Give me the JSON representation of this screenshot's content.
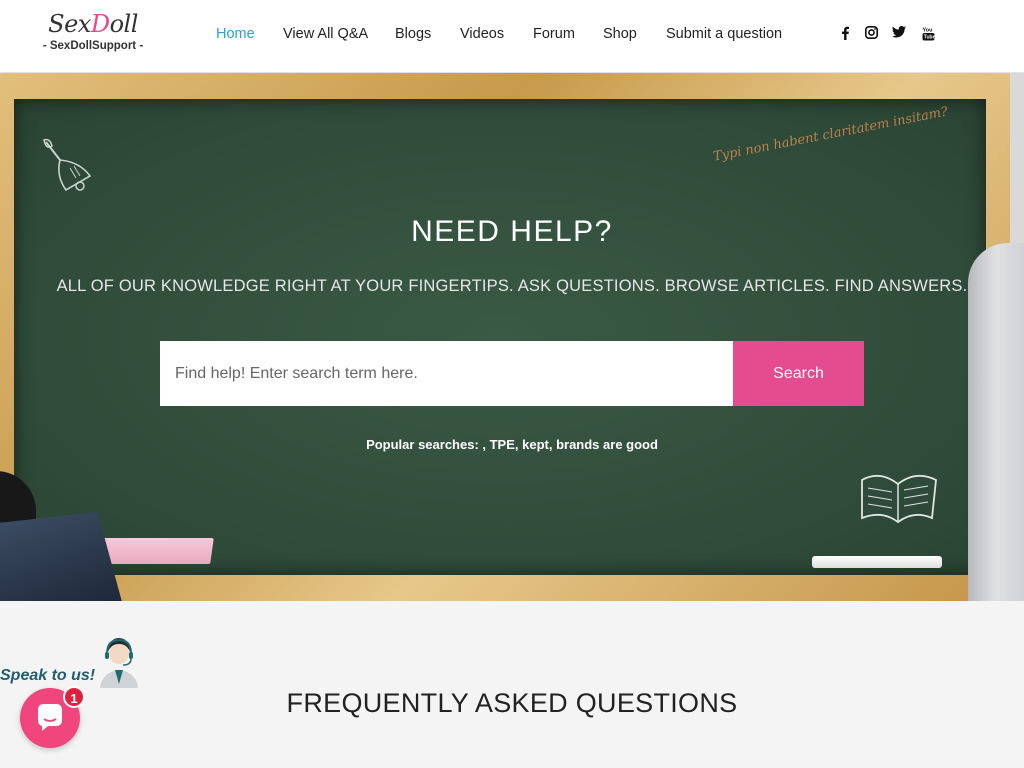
{
  "header": {
    "logo": {
      "main_prefix": "Sex",
      "main_accent": "D",
      "main_suffix": "oll",
      "sub": "- SexDollSupport -"
    },
    "nav": [
      {
        "label": "Home",
        "active": true
      },
      {
        "label": "View All Q&A"
      },
      {
        "label": "Blogs"
      },
      {
        "label": "Videos"
      },
      {
        "label": "Forum"
      },
      {
        "label": "Shop"
      },
      {
        "label": "Submit a question"
      }
    ],
    "social": [
      {
        "icon": "facebook-icon",
        "glyph": "f"
      },
      {
        "icon": "instagram-icon",
        "glyph": "◙"
      },
      {
        "icon": "twitter-icon",
        "glyph": "🐦"
      },
      {
        "icon": "youtube-icon",
        "glyph": "▶"
      }
    ]
  },
  "hero": {
    "chalk_note": "Typi non habent claritatem insitam?",
    "title": "NEED HELP?",
    "subtitle": "ALL OF OUR KNOWLEDGE RIGHT AT YOUR FINGERTIPS. ASK QUESTIONS. BROWSE ARTICLES. FIND ANSWERS.",
    "search": {
      "placeholder": "Find help! Enter search term here.",
      "value": "",
      "button_label": "Search"
    },
    "popular_searches": "Popular searches: , TPE, kept, brands are good"
  },
  "faq": {
    "title": "FREQUENTLY ASKED QUESTIONS"
  },
  "chat_widget": {
    "speak_label": "Speak to us!",
    "badge_count": "1"
  },
  "colors": {
    "accent_pink": "#e54b8f",
    "nav_active": "#2a9fd6",
    "chalkboard": "#2f4b39",
    "frame_wood": "#d6ae62"
  }
}
